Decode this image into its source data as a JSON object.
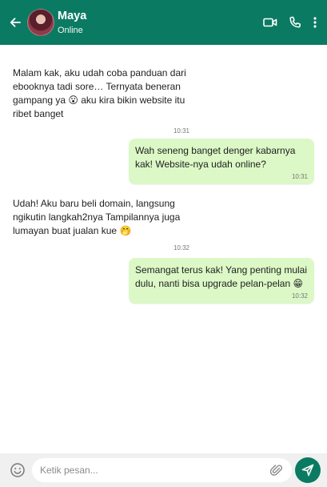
{
  "header": {
    "name": "Maya",
    "status": "Online",
    "accent": "#0b7a62"
  },
  "icons": {
    "back": "arrow-left-icon",
    "video": "video-call-icon",
    "call": "phone-icon",
    "menu": "more-vertical-icon",
    "emoji": "smiley-icon",
    "attach": "paperclip-icon",
    "send": "send-icon"
  },
  "messages": [
    {
      "direction": "incoming",
      "text": "Malam kak, aku udah coba panduan dari ebooknya tadi sore… Ternyata beneran gampang ya",
      "emoji": "😮",
      "text2": " aku kira bikin website itu ribet banget",
      "time": "10:31"
    },
    {
      "direction": "outgoing",
      "text": "Wah seneng banget denger kabarnya kak! Website-nya udah online?",
      "time": "10:31",
      "bubble_color": "#dcf8c6"
    },
    {
      "direction": "incoming",
      "text": "Udah! Aku baru beli domain, langsung ngikutin langkah2nya Tampilannya juga lumayan buat jualan kue",
      "emoji": "🤭",
      "time": "10:32"
    },
    {
      "direction": "outgoing",
      "text": "Semangat terus kak! Yang penting mulai dulu, nanti bisa upgrade pelan-pelan",
      "emoji": "😁",
      "time": "10:32",
      "bubble_color": "#dcf8c6"
    }
  ],
  "composer": {
    "placeholder": "Ketik pesan..."
  }
}
